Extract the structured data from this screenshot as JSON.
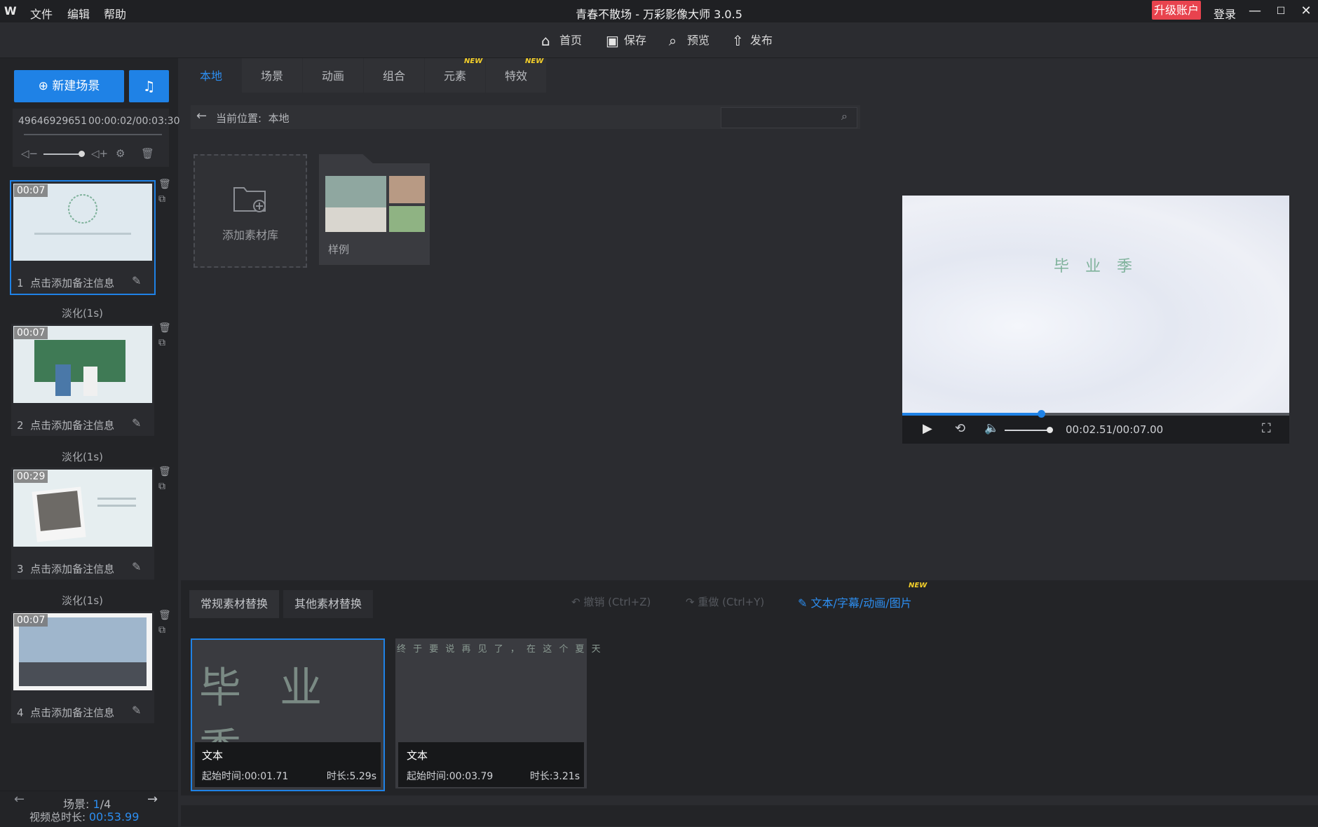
{
  "menu": {
    "logo": "W",
    "items": [
      "文件",
      "编辑",
      "帮助"
    ]
  },
  "window": {
    "title": "青春不散场 - 万彩影像大师 3.0.5",
    "upgrade": "升级账户",
    "login": "登录",
    "minimize": "—",
    "maximize": "☐",
    "close": "✕"
  },
  "toolbar": {
    "home": "首页",
    "save": "保存",
    "preview": "预览",
    "publish": "发布"
  },
  "left": {
    "new_scene": "新建场景",
    "music_id": "49646929651",
    "music_time": "00:00:02/00:03:30",
    "scenes": [
      {
        "num": "1",
        "dur": "00:07",
        "note": "点击添加备注信息"
      },
      {
        "num": "2",
        "dur": "00:07",
        "note": "点击添加备注信息"
      },
      {
        "num": "3",
        "dur": "00:29",
        "note": "点击添加备注信息"
      },
      {
        "num": "4",
        "dur": "00:07",
        "note": "点击添加备注信息"
      }
    ],
    "transitions": [
      "淡化(1s)",
      "淡化(1s)",
      "淡化(1s)"
    ],
    "scene_label": "场景:",
    "scene_current": "1",
    "scene_total": "/4",
    "total_label": "视频总时长:",
    "total_value": "00:53.99"
  },
  "tabs": [
    {
      "label": "本地",
      "active": true
    },
    {
      "label": "场景"
    },
    {
      "label": "动画"
    },
    {
      "label": "组合"
    },
    {
      "label": "元素",
      "badge": "NEW"
    },
    {
      "label": "特效",
      "badge": "NEW"
    }
  ],
  "path": {
    "label": "当前位置:",
    "value": "本地"
  },
  "library": {
    "add": "添加素材库",
    "sample": "样例"
  },
  "preview": {
    "text": "毕 业 季",
    "time": "00:02.51/00:07.00",
    "progress": 0.36
  },
  "bottom": {
    "tabs": [
      "常规素材替换",
      "其他素材替换"
    ],
    "undo": "撤销 (Ctrl+Z)",
    "redo": "重做 (Ctrl+Y)",
    "edit_link": "文本/字幕/动画/图片",
    "edit_badge": "NEW",
    "cards": [
      {
        "preview": "毕 业 季",
        "type": "文本",
        "start": "起始时间:00:01.71",
        "length": "时长:5.29s"
      },
      {
        "preview": "终 于 要 说 再 见 了 ， 在 这 个 夏 天",
        "type": "文本",
        "start": "起始时间:00:03.79",
        "length": "时长:3.21s"
      }
    ]
  }
}
